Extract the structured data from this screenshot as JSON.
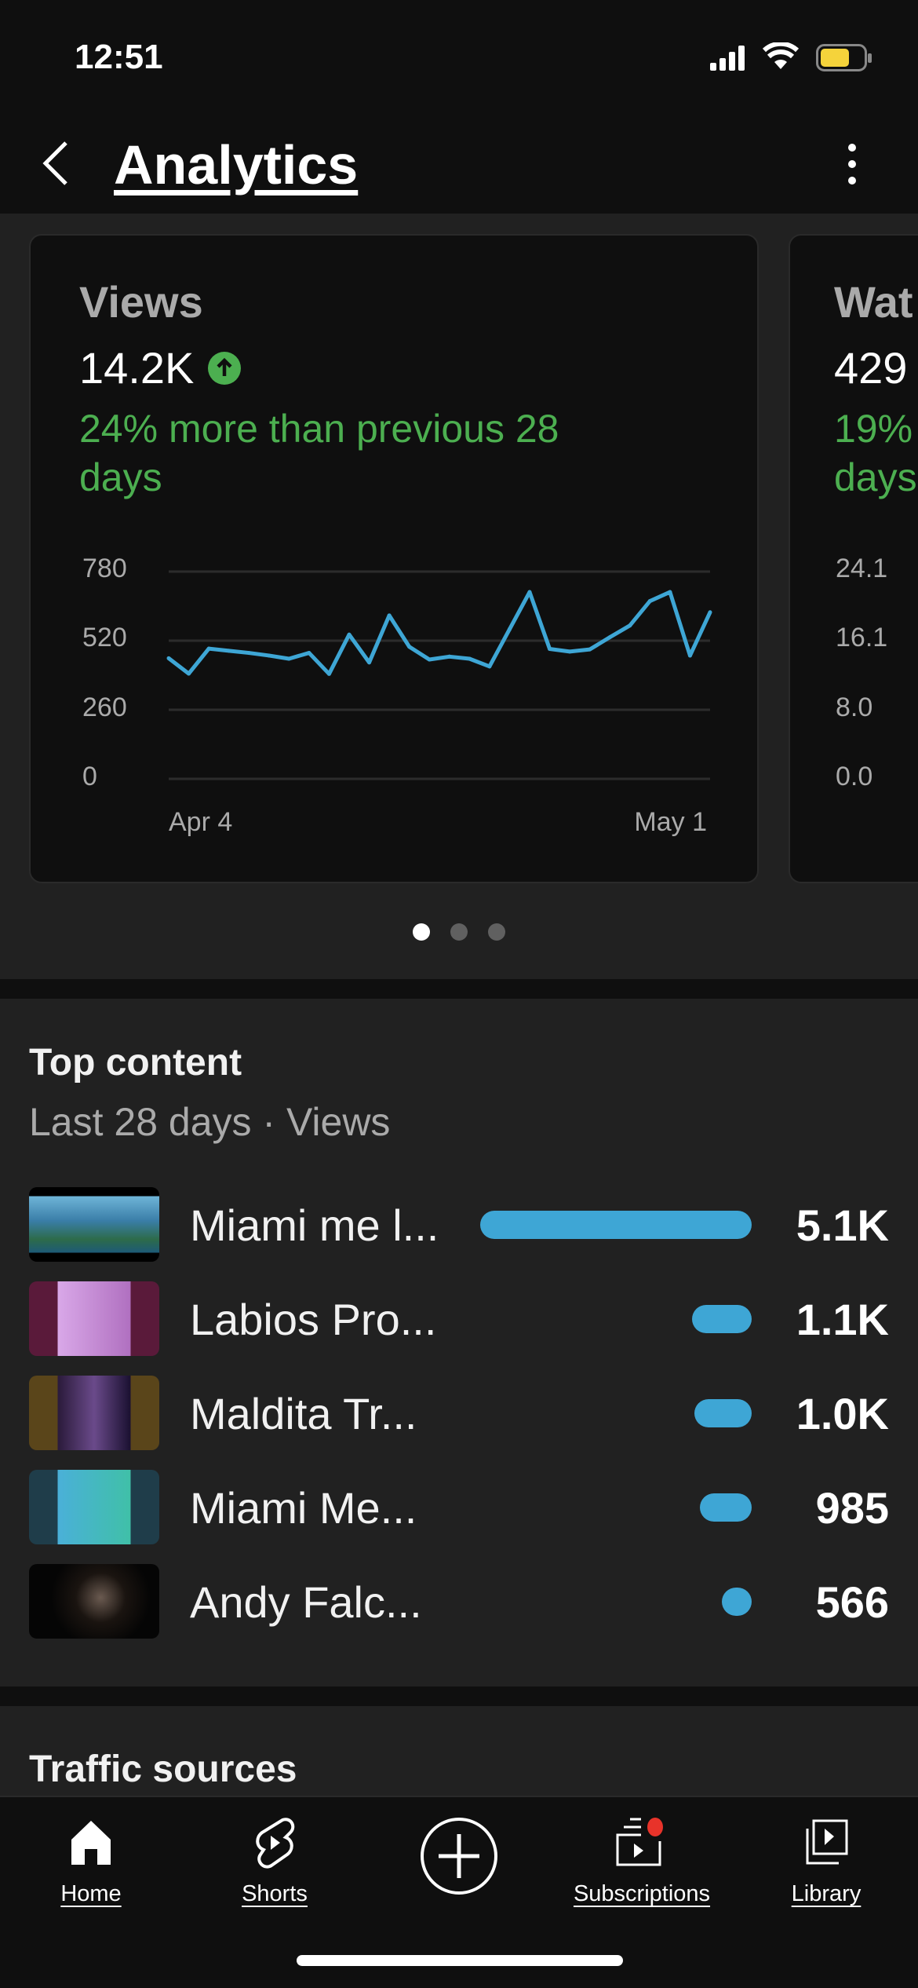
{
  "status_bar": {
    "time": "12:51",
    "battery_color": "#f5d33b"
  },
  "header": {
    "title": "Analytics",
    "back_icon": "chevron-left-icon",
    "menu_icon": "more-vertical-icon"
  },
  "cards": [
    {
      "title": "Views",
      "value": "14.2K",
      "trend_icon": "arrow-up-circle-icon",
      "delta": [
        "24% more than previous 28",
        "days"
      ]
    },
    {
      "title": "Wat",
      "value": "429",
      "delta": [
        "19%",
        "days"
      ],
      "y_ticks": [
        "24.1",
        "16.1",
        "8.0",
        "0.0"
      ]
    }
  ],
  "chart_data": {
    "type": "line",
    "x_start": "Apr 4",
    "x_end": "May 1",
    "x_ticks": [
      "Apr 4",
      "May 1"
    ],
    "y_ticks": [
      "780",
      "520",
      "260",
      "0"
    ],
    "ylim": [
      0,
      780
    ],
    "grid": true,
    "color": "#3ea6d5",
    "values": [
      454,
      396,
      490,
      482,
      474,
      464,
      452,
      474,
      395,
      543,
      438,
      615,
      497,
      449,
      460,
      452,
      423,
      563,
      703,
      489,
      479,
      487,
      533,
      577,
      669,
      703,
      464,
      627
    ]
  },
  "pager": {
    "count": 3,
    "active": 0
  },
  "top_content": {
    "title": "Top content",
    "subtitle": "Last 28 days · Views",
    "items": [
      {
        "title": "Miami me l...",
        "views": "5.1K",
        "share": 1.0
      },
      {
        "title": "Labios Pro...",
        "views": "1.1K",
        "share": 0.22
      },
      {
        "title": "Maldita Tr...",
        "views": "1.0K",
        "share": 0.21
      },
      {
        "title": "Miami Me...",
        "views": "985",
        "share": 0.19
      },
      {
        "title": "Andy Falc...",
        "views": "566",
        "share": 0.11
      }
    ]
  },
  "traffic_sources": {
    "title": "Traffic sources"
  },
  "nav": [
    {
      "label": "Home",
      "icon": "home-icon"
    },
    {
      "label": "Shorts",
      "icon": "shorts-icon"
    },
    {
      "label": "",
      "icon": "create-plus-icon"
    },
    {
      "label": "Subscriptions",
      "icon": "subscriptions-icon",
      "badge_color": "#e8332a"
    },
    {
      "label": "Library",
      "icon": "library-icon"
    }
  ]
}
